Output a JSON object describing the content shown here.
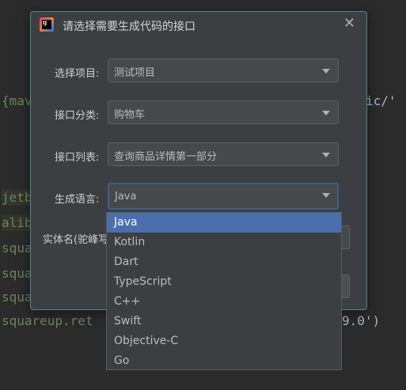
{
  "background_code": {
    "line1_left": "{mave",
    "line1_right": "ic/'",
    "line2": "jetb",
    "line3": "alib",
    "line4": "squa",
    "line5": "squa",
    "line6": "squa",
    "line7_left": "squareup.ret",
    "line7_right": "9.0')"
  },
  "dialog": {
    "title": "请选择需要生成代码的接口",
    "icon_letters": "IJ",
    "close_glyph": "✕",
    "fields": {
      "project_label": "选择项目:",
      "project_value": "测试项目",
      "category_label": "接口分类:",
      "category_value": "购物车",
      "api_label": "接口列表:",
      "api_value": "查询商品详情第一部分",
      "language_label": "生成语言:",
      "language_value": "Java",
      "entity_label": "实体名(驼峰写"
    }
  },
  "language_dropdown": {
    "options": [
      "Java",
      "Kotlin",
      "Dart",
      "TypeScript",
      "C++",
      "Swift",
      "Objective-C",
      "Go"
    ],
    "selected": "Java"
  },
  "colors": {
    "accent_border": "#3f8d9c",
    "selected_item": "#4b6eaf",
    "string_green": "#6a8759"
  }
}
